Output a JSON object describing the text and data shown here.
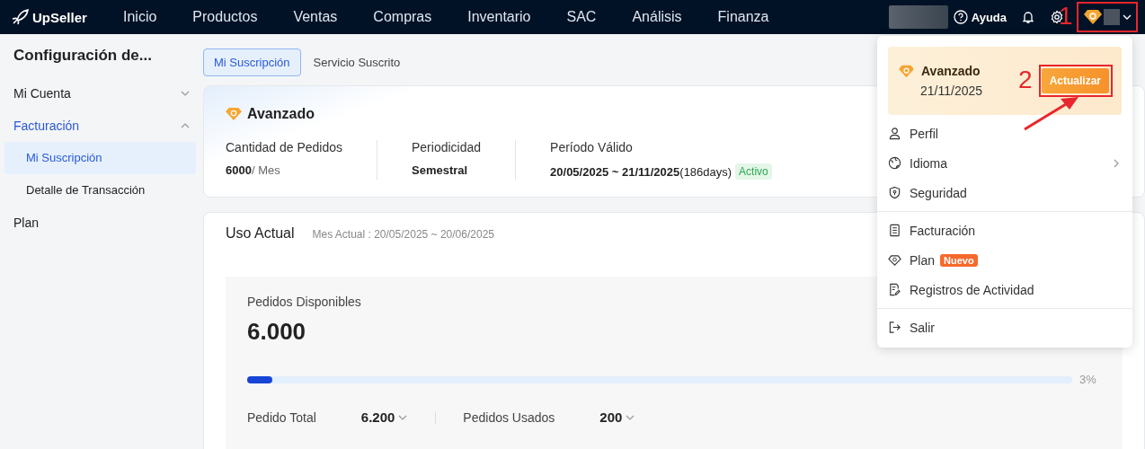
{
  "nav": {
    "logo": "UpSeller",
    "items": [
      {
        "label": "Inicio",
        "selected": false
      },
      {
        "label": "Productos",
        "selected": false
      },
      {
        "label": "Ventas",
        "selected": false
      },
      {
        "label": "Compras",
        "selected": false
      },
      {
        "label": "Inventario",
        "selected": false
      },
      {
        "label": "SAC",
        "selected": false
      },
      {
        "label": "Análisis",
        "selected": false
      },
      {
        "label": "Finanza",
        "selected": false
      }
    ],
    "help": "Ayuda"
  },
  "sidebar": {
    "title": "Configuración de...",
    "items": [
      {
        "label": "Mi Cuenta",
        "kind": "group",
        "expanded": false,
        "selected": false
      },
      {
        "label": "Facturación",
        "kind": "group",
        "expanded": true,
        "selected": true,
        "children": [
          {
            "label": "Mi Suscripción",
            "selected": true
          },
          {
            "label": "Detalle de Transacción",
            "selected": false
          }
        ]
      },
      {
        "label": "Plan",
        "kind": "link",
        "selected": false
      }
    ]
  },
  "tabs": [
    {
      "label": "Mi Suscripción",
      "selected": true
    },
    {
      "label": "Servicio Suscrito",
      "selected": false
    }
  ],
  "plan_card": {
    "name": "Avanzado",
    "fields": [
      {
        "label": "Cantidad de Pedidos",
        "value": "6000",
        "unit": "/ Mes"
      },
      {
        "label": "Periodicidad",
        "value": "Semestral"
      },
      {
        "label": "Período Válido",
        "value": "20/05/2025 ~ 21/11/2025",
        "note": "(186days)",
        "badge": "Activo"
      }
    ]
  },
  "usage": {
    "title": "Uso Actual",
    "period": "Mes Actual : 20/05/2025 ~ 20/06/2025",
    "available_label": "Pedidos Disponibles",
    "available": "6.000",
    "level": 0.03,
    "percent": "3%",
    "stats": [
      {
        "label": "Pedido Total",
        "value": "6.200"
      },
      {
        "label": "Pedidos Usados",
        "value": "200"
      }
    ]
  },
  "dropdown": {
    "plan": "Avanzado",
    "expiry": "21/11/2025",
    "upgrade": "Actualizar",
    "sections": [
      [
        {
          "label": "Perfil",
          "submenu": false
        },
        {
          "label": "Idioma",
          "submenu": true
        },
        {
          "label": "Seguridad",
          "submenu": false
        }
      ],
      [
        {
          "label": "Facturación",
          "submenu": false
        },
        {
          "label": "Plan",
          "submenu": false,
          "badge": "Nuevo"
        },
        {
          "label": "Registros de Actividad",
          "submenu": false
        }
      ],
      [
        {
          "label": "Salir",
          "submenu": false
        }
      ]
    ]
  },
  "annotations": [
    {
      "label": "1"
    },
    {
      "label": "2"
    }
  ]
}
